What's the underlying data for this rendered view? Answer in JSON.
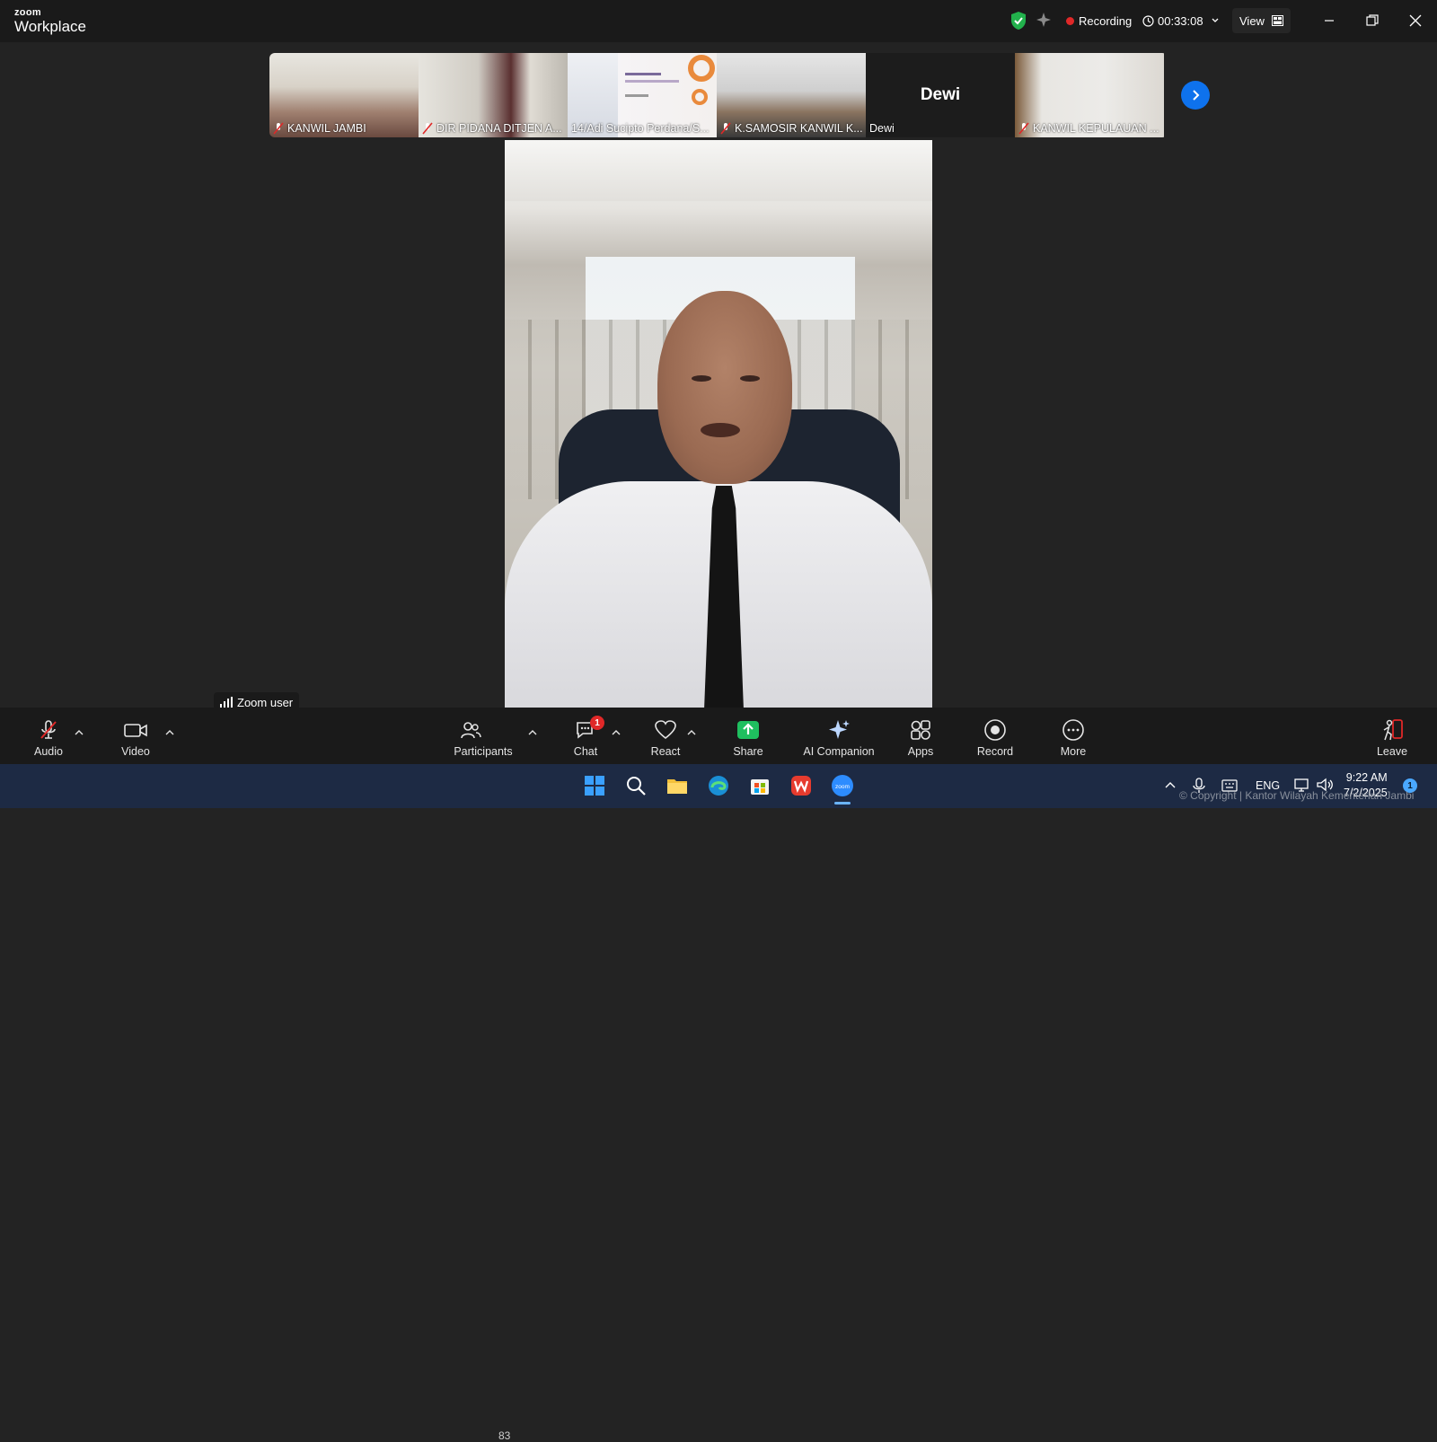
{
  "app": {
    "logo_small": "zoom",
    "logo_big": "Workplace"
  },
  "titlebar": {
    "recording_label": "Recording",
    "timer": "00:33:08",
    "view_label": "View"
  },
  "thumbnails": [
    {
      "label": "KANWIL JAMBI",
      "muted": true
    },
    {
      "label": "DIR PIDANA DITJEN A...",
      "muted": true
    },
    {
      "label": "14/Adi Sucipto Perdana/S...",
      "muted": false
    },
    {
      "label": "K.SAMOSIR KANWIL K...",
      "muted": true
    },
    {
      "label": "Dewi",
      "muted": false,
      "display_name": "Dewi"
    },
    {
      "label": "KANWIL KEPULAUAN ...",
      "muted": true
    }
  ],
  "main_video": {
    "speaker_label": "Zoom user"
  },
  "toolbar": {
    "audio": "Audio",
    "video": "Video",
    "participants": "Participants",
    "participants_count": "83",
    "chat": "Chat",
    "chat_badge": "1",
    "react": "React",
    "share": "Share",
    "ai_companion": "AI Companion",
    "apps": "Apps",
    "record": "Record",
    "more": "More",
    "leave": "Leave"
  },
  "taskbar": {
    "lang": "ENG",
    "time": "9:22 AM",
    "date": "7/2/2025",
    "notification_count": "1",
    "copyright": "© Copyright | Kantor Wilayah Kementerian Jambi"
  },
  "colors": {
    "accent": "#0e72ed",
    "record": "#e02828",
    "share": "#1fbf5f",
    "titlebar": "#1a1a1a",
    "taskbar": "#1d2a44"
  }
}
